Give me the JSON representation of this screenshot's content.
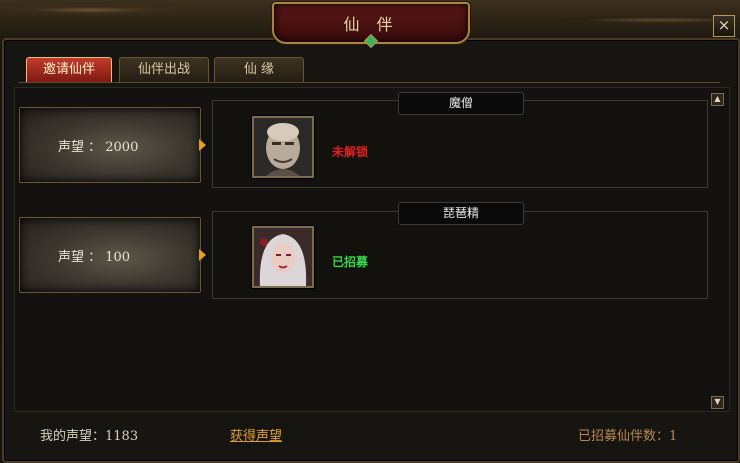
{
  "window": {
    "title": "仙 伴",
    "close_label": "×"
  },
  "tabs": [
    {
      "label": "邀请仙伴",
      "active": true
    },
    {
      "label": "仙伴出战",
      "active": false
    },
    {
      "label": "仙  缘",
      "active": false
    }
  ],
  "companions": [
    {
      "reputation_label": "声望 ： 2000",
      "name": "魔僧",
      "status": "未解锁",
      "status_color": "#e11d1d"
    },
    {
      "reputation_label": "声望 ： 100",
      "name": "琵琶精",
      "status": "已招募",
      "status_color": "#35d84a"
    }
  ],
  "scroll": {
    "up_icon": "▲",
    "down_icon": "▼"
  },
  "footer": {
    "my_reputation": "我的声望：1183",
    "get_reputation_link": "获得声望",
    "recruited_count": "已招募仙伴数：1"
  },
  "colors": {
    "accent_tab": "#c23b2d",
    "gold_border": "#a8853d",
    "link": "#e0a02a"
  }
}
